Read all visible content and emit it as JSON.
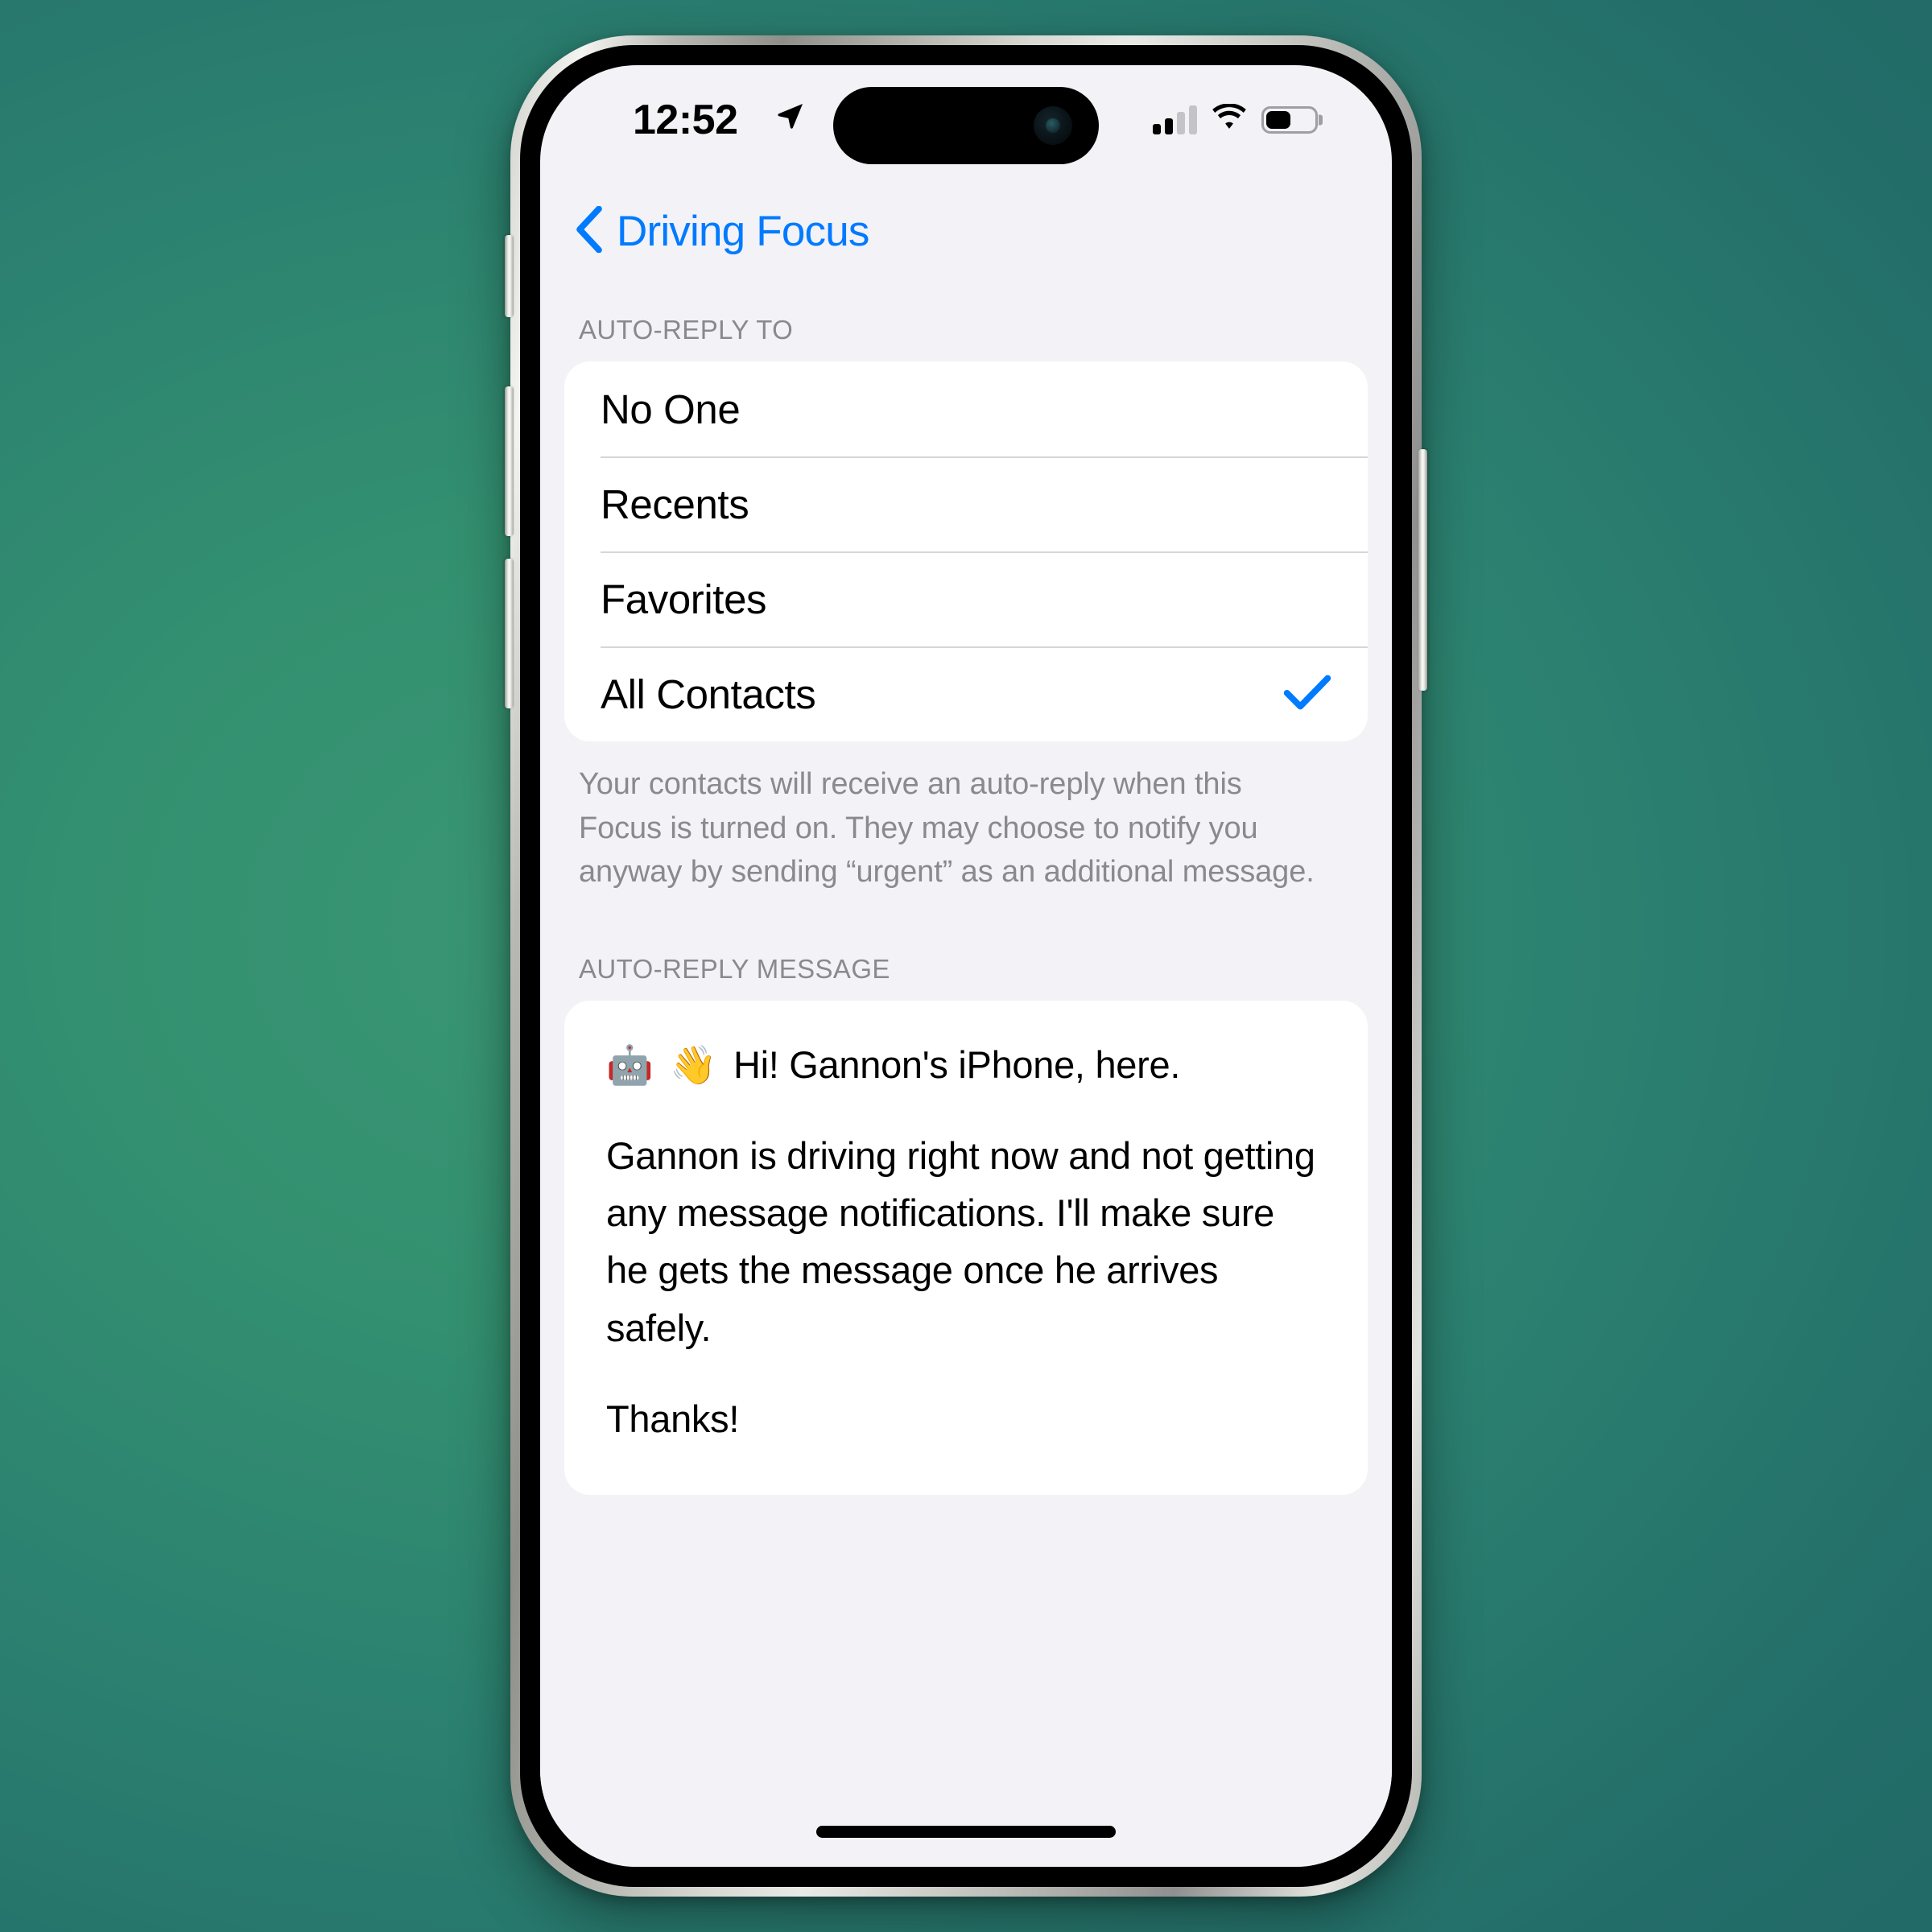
{
  "status_bar": {
    "time": "12:52",
    "location_icon": "location-arrow-icon",
    "signal_icon": "cellular-signal-icon",
    "signal_bars_filled": 2,
    "signal_bars_total": 4,
    "wifi_icon": "wifi-icon",
    "battery_icon": "battery-icon",
    "battery_level_percent": 47
  },
  "nav": {
    "back_icon": "chevron-left-icon",
    "back_label": "Driving Focus"
  },
  "sections": {
    "auto_reply_to": {
      "header": "AUTO-REPLY TO",
      "options": [
        {
          "label": "No One",
          "selected": false
        },
        {
          "label": "Recents",
          "selected": false
        },
        {
          "label": "Favorites",
          "selected": false
        },
        {
          "label": "All Contacts",
          "selected": true
        }
      ],
      "selected_value": "All Contacts",
      "check_icon": "checkmark-icon",
      "footer": "Your contacts will receive an auto-reply when this Focus is turned on. They may choose to notify you anyway by sending “urgent” as an additional message."
    },
    "auto_reply_message": {
      "header": "AUTO-REPLY MESSAGE",
      "emoji_robot": "🤖",
      "emoji_wave": "👋",
      "greeting": "Hi! Gannon's iPhone, here.",
      "body": "Gannon is driving right now and not getting any message notifications. I'll make sure he gets the message once he arrives safely.",
      "closing": "Thanks!"
    }
  },
  "colors": {
    "accent_blue": "#007aff",
    "background_grouped": "#f2f2f7",
    "card_white": "#ffffff",
    "secondary_label": "#8a8a8e",
    "separator": "#d6d6da",
    "wallpaper_teal": "#2b8070"
  },
  "device": {
    "home_indicator": "home-indicator",
    "dynamic_island": "dynamic-island",
    "front_camera": "front-camera-icon",
    "mute_switch": "mute-switch-button",
    "volume_up": "volume-up-button",
    "volume_down": "volume-down-button",
    "power": "power-button"
  }
}
